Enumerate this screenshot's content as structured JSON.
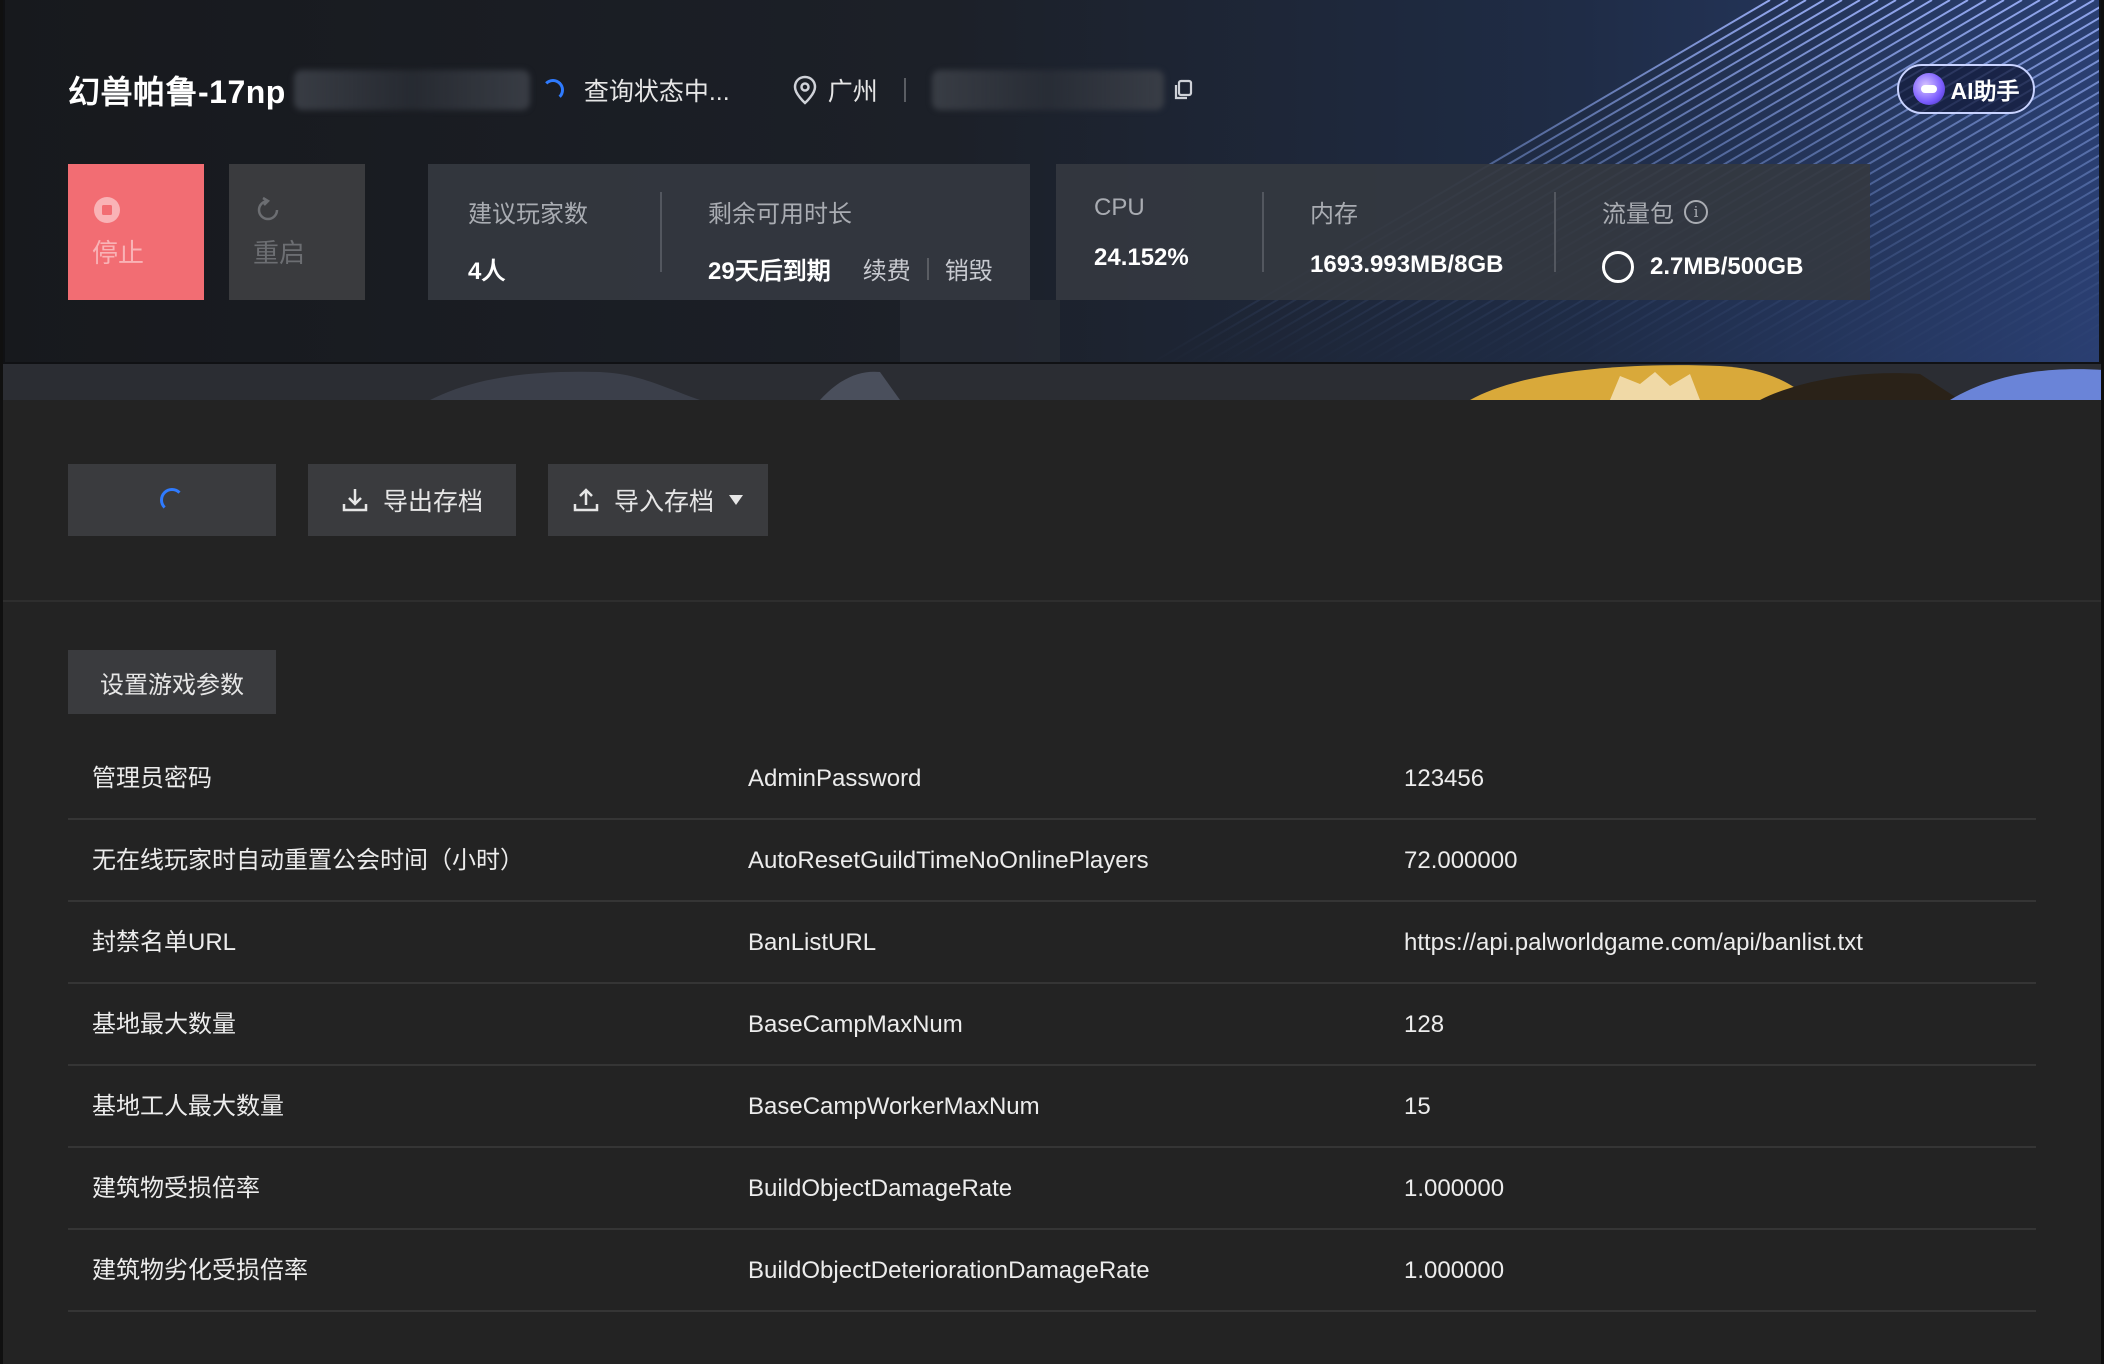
{
  "header": {
    "server_name": "幻兽帕鲁-17np",
    "status_text": "查询状态中...",
    "region": "广州",
    "ai_label": "AI助手"
  },
  "controls": {
    "stop_label": "停止",
    "restart_label": "重启"
  },
  "players_card": {
    "players_label": "建议玩家数",
    "players_value": "4人",
    "remaining_label": "剩余可用时长",
    "remaining_value": "29天后到期",
    "renew_label": "续费",
    "destroy_label": "销毁"
  },
  "resources_card": {
    "cpu_label": "CPU",
    "cpu_value": "24.152%",
    "memory_label": "内存",
    "memory_value": "1693.993MB/8GB",
    "traffic_label": "流量包",
    "traffic_value": "2.7MB/500GB"
  },
  "toolbar": {
    "export_label": "导出存档",
    "import_label": "导入存档"
  },
  "settings": {
    "button_label": "设置游戏参数",
    "params": [
      {
        "name": "管理员密码",
        "key": "AdminPassword",
        "value": "123456"
      },
      {
        "name": "无在线玩家时自动重置公会时间（小时）",
        "key": "AutoResetGuildTimeNoOnlinePlayers",
        "value": "72.000000"
      },
      {
        "name": "封禁名单URL",
        "key": "BanListURL",
        "value": "https://api.palworldgame.com/api/banlist.txt"
      },
      {
        "name": "基地最大数量",
        "key": "BaseCampMaxNum",
        "value": "128"
      },
      {
        "name": "基地工人最大数量",
        "key": "BaseCampWorkerMaxNum",
        "value": "15"
      },
      {
        "name": "建筑物受损倍率",
        "key": "BuildObjectDamageRate",
        "value": "1.000000"
      },
      {
        "name": "建筑物劣化受损倍率",
        "key": "BuildObjectDeteriorationDamageRate",
        "value": "1.000000"
      }
    ]
  },
  "colors": {
    "stop_bg": "#f26d73",
    "accent_blue": "#2f7bff",
    "page_bg": "#232323"
  }
}
